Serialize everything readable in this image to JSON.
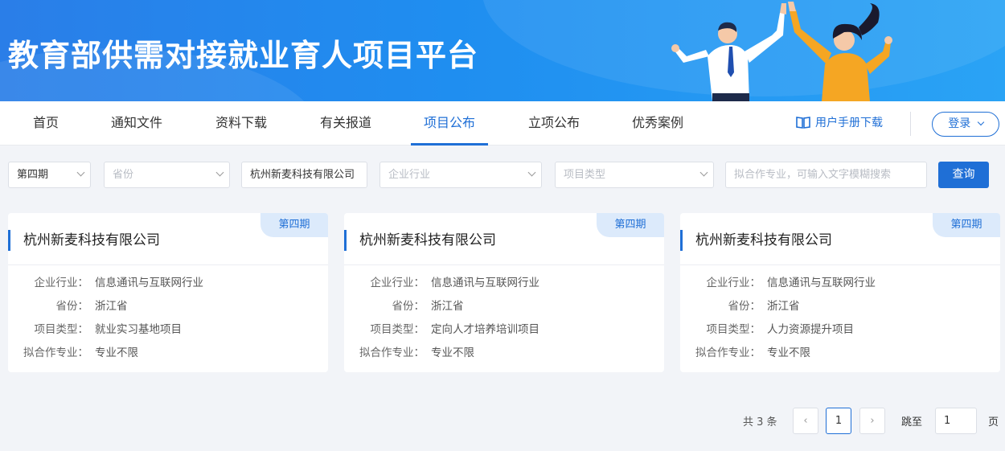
{
  "banner": {
    "title": "教育部供需对接就业育人项目平台"
  },
  "nav": {
    "items": [
      {
        "label": "首页"
      },
      {
        "label": "通知文件"
      },
      {
        "label": "资料下载"
      },
      {
        "label": "有关报道"
      },
      {
        "label": "项目公布",
        "active": true
      },
      {
        "label": "立项公布"
      },
      {
        "label": "优秀案例"
      }
    ],
    "manual": "用户手册下载",
    "manual_icon": "book-icon",
    "login": "登录"
  },
  "filters": {
    "period": "第四期",
    "province_placeholder": "省份",
    "company": "杭州新麦科技有限公司",
    "industry_placeholder": "企业行业",
    "type_placeholder": "项目类型",
    "major_placeholder": "拟合作专业，可输入文字模糊搜索",
    "search": "查询"
  },
  "labels": {
    "industry": "企业行业：",
    "province": "省份：",
    "type": "项目类型：",
    "major": "拟合作专业："
  },
  "cards": [
    {
      "badge": "第四期",
      "name": "杭州新麦科技有限公司",
      "industry": "信息通讯与互联网行业",
      "province": "浙江省",
      "type": "就业实习基地项目",
      "major": "专业不限"
    },
    {
      "badge": "第四期",
      "name": "杭州新麦科技有限公司",
      "industry": "信息通讯与互联网行业",
      "province": "浙江省",
      "type": "定向人才培养培训项目",
      "major": "专业不限"
    },
    {
      "badge": "第四期",
      "name": "杭州新麦科技有限公司",
      "industry": "信息通讯与互联网行业",
      "province": "浙江省",
      "type": "人力资源提升项目",
      "major": "专业不限"
    }
  ],
  "pagination": {
    "total": "共 3 条",
    "prev": "‹",
    "current": "1",
    "next": "›",
    "jump_label": "跳至",
    "jump_value": "1",
    "page_suffix": "页"
  }
}
